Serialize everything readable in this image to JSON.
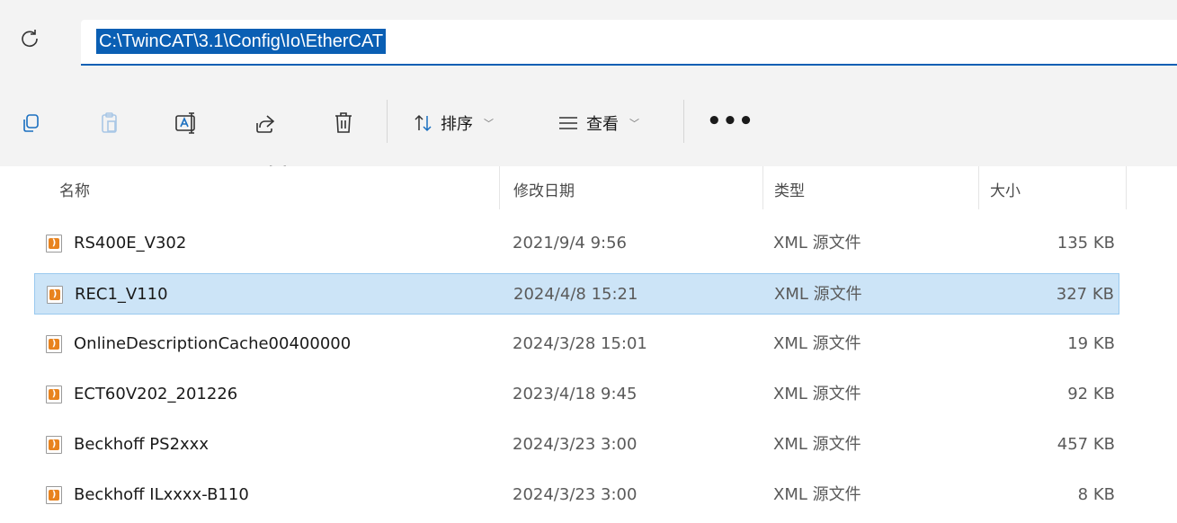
{
  "address_bar": {
    "path": "C:\\TwinCAT\\3.1\\Config\\Io\\EtherCAT"
  },
  "toolbar": {
    "sort_label": "排序",
    "view_label": "查看",
    "more_label": "•••",
    "icons": [
      "copy-icon",
      "paste-icon",
      "rename-icon",
      "share-icon",
      "delete-icon",
      "sort-icon",
      "view-icon"
    ]
  },
  "columns": {
    "name": "名称",
    "modified": "修改日期",
    "type": "类型",
    "size": "大小"
  },
  "files": [
    {
      "name": "RS400E_V302",
      "modified": "2021/9/4 9:56",
      "type": "XML 源文件",
      "size": "135 KB",
      "selected": false
    },
    {
      "name": "REC1_V110",
      "modified": "2024/4/8 15:21",
      "type": "XML 源文件",
      "size": "327 KB",
      "selected": true
    },
    {
      "name": "OnlineDescriptionCache00400000",
      "modified": "2024/3/28 15:01",
      "type": "XML 源文件",
      "size": "19 KB",
      "selected": false
    },
    {
      "name": "ECT60V202_201226",
      "modified": "2023/4/18 9:45",
      "type": "XML 源文件",
      "size": "92 KB",
      "selected": false
    },
    {
      "name": "Beckhoff PS2xxx",
      "modified": "2024/3/23 3:00",
      "type": "XML 源文件",
      "size": "457 KB",
      "selected": false
    },
    {
      "name": "Beckhoff ILxxxx-B110",
      "modified": "2024/3/23 3:00",
      "type": "XML 源文件",
      "size": "8 KB",
      "selected": false
    }
  ],
  "colors": {
    "selection_bg": "#cce4f7",
    "selection_border": "#99c9ef",
    "address_highlight": "#0a5fb4",
    "xml_icon": "#e8831e"
  }
}
